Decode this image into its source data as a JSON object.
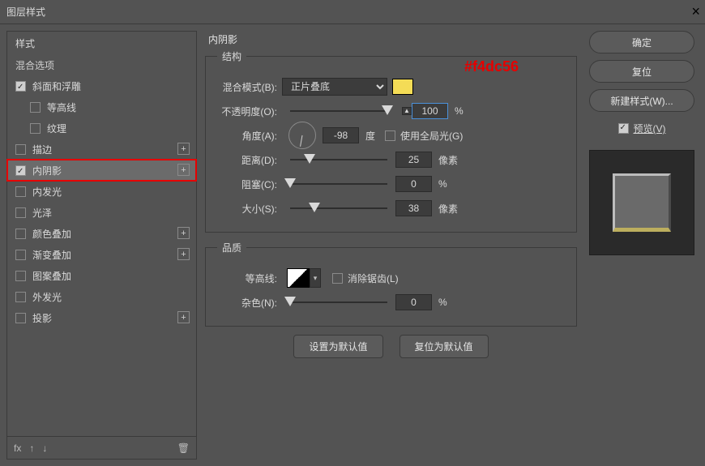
{
  "window": {
    "title": "图层样式"
  },
  "annotation": "#f4dc56",
  "sidebar": {
    "header": "样式",
    "sub": "混合选项",
    "items": [
      {
        "label": "斜面和浮雕",
        "checked": true,
        "plus": false,
        "indent": false
      },
      {
        "label": "等高线",
        "checked": false,
        "plus": false,
        "indent": true
      },
      {
        "label": "纹理",
        "checked": false,
        "plus": false,
        "indent": true
      },
      {
        "label": "描边",
        "checked": false,
        "plus": true,
        "indent": false
      },
      {
        "label": "内阴影",
        "checked": true,
        "plus": true,
        "indent": false,
        "active": true,
        "hl": true
      },
      {
        "label": "内发光",
        "checked": false,
        "plus": false,
        "indent": false
      },
      {
        "label": "光泽",
        "checked": false,
        "plus": false,
        "indent": false
      },
      {
        "label": "颜色叠加",
        "checked": false,
        "plus": true,
        "indent": false
      },
      {
        "label": "渐变叠加",
        "checked": false,
        "plus": true,
        "indent": false
      },
      {
        "label": "图案叠加",
        "checked": false,
        "plus": false,
        "indent": false
      },
      {
        "label": "外发光",
        "checked": false,
        "plus": false,
        "indent": false
      },
      {
        "label": "投影",
        "checked": false,
        "plus": true,
        "indent": false
      }
    ],
    "footer": {
      "fx": "fx",
      "up": "↑",
      "down": "↓",
      "trash": "🗑"
    }
  },
  "main": {
    "title": "内阴影",
    "structure": {
      "legend": "结构",
      "blend_mode": {
        "label": "混合模式(B):",
        "value": "正片叠底",
        "swatch": "#f4dc56"
      },
      "opacity": {
        "label": "不透明度(O):",
        "value": "100",
        "unit": "%",
        "pos": 100
      },
      "angle": {
        "label": "角度(A):",
        "value": "-98",
        "unit": "度",
        "global_label": "使用全局光(G)",
        "global": false
      },
      "distance": {
        "label": "距离(D):",
        "value": "25",
        "unit": "像素",
        "pos": 20
      },
      "choke": {
        "label": "阻塞(C):",
        "value": "0",
        "unit": "%",
        "pos": 0
      },
      "size": {
        "label": "大小(S):",
        "value": "38",
        "unit": "像素",
        "pos": 25
      }
    },
    "quality": {
      "legend": "品质",
      "contour": {
        "label": "等高线:",
        "anti_label": "消除锯齿(L)",
        "anti": false
      },
      "noise": {
        "label": "杂色(N):",
        "value": "0",
        "unit": "%",
        "pos": 0
      }
    },
    "buttons": {
      "default": "设置为默认值",
      "reset": "复位为默认值"
    }
  },
  "right": {
    "ok": "确定",
    "cancel": "复位",
    "newstyle": "新建样式(W)...",
    "preview": {
      "label": "预览(V)",
      "checked": true
    }
  }
}
